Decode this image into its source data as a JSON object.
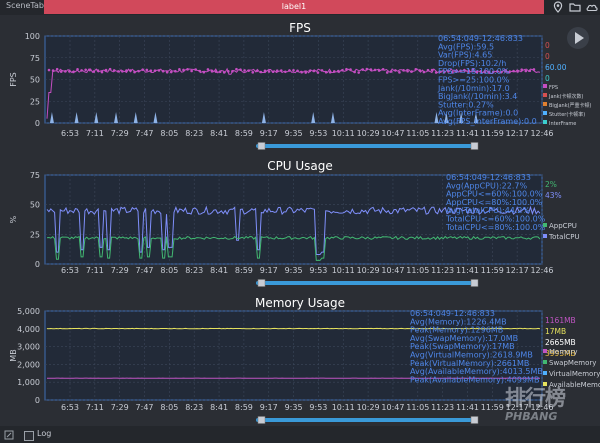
{
  "window": {
    "scene_tab": "SceneTab",
    "tab_label": "label1"
  },
  "toolbar_icons": [
    "location-pin-icon",
    "folder-icon",
    "cloud-icon"
  ],
  "bottom": {
    "log_label": "Log"
  },
  "watermark": {
    "cn": "排行榜",
    "en": "PHBANG"
  },
  "x_ticks": [
    "6:53",
    "7:11",
    "7:29",
    "7:47",
    "8:05",
    "8:23",
    "8:41",
    "8:59",
    "9:17",
    "9:35",
    "9:53",
    "10:11",
    "10:29",
    "10:47",
    "11:05",
    "11:23",
    "11:41",
    "11:59",
    "12:17",
    "12:46"
  ],
  "colors": {
    "panel_bg": "#2a3344",
    "plot_bg": "#222a38",
    "grid": "#3c475a",
    "fps": "#c44ec2",
    "appcpu": "#7f8ffb",
    "totalcpu": "#42b872",
    "memory": "#c055c3",
    "virtual": "#e6e25e",
    "stats": "#4e86e8",
    "scrollbar": "#3a9ad9"
  },
  "chart_data": [
    {
      "type": "line",
      "title": "FPS",
      "ylabel": "FPS",
      "ylim": [
        0,
        100
      ],
      "yticks": [
        "0",
        "25",
        "50",
        "75",
        "100"
      ],
      "stats": [
        "06:54:049-12:46:833",
        "Avg(FPS):59.5",
        "Var(FPS):4.65",
        "Drop(FPS):10.2/h",
        "FPS>=18:100.0%",
        "FPS>=25:100.0%",
        "Jank(/10min):17.0",
        "BigJank(/10min):3.4",
        "Stutter:0.27%",
        "Avg(InterFrame):0.0",
        "Avg(FPS_InterFrame):0.0"
      ],
      "right_values": [
        {
          "text": "0",
          "color": "#d55050"
        },
        {
          "text": "0",
          "color": "#d55050"
        },
        {
          "text": "60.00",
          "color": "#4fb0ff"
        },
        {
          "text": "0",
          "color": "#3ccfcf"
        }
      ],
      "legend": [
        {
          "name": "FPS",
          "color": "#c44ec2"
        },
        {
          "name": "Jank(卡顿次数)",
          "color": "#d55050"
        },
        {
          "name": "BigJank(严重卡顿)",
          "color": "#e08030"
        },
        {
          "name": "Stutter(卡顿率)",
          "color": "#4fb0ff"
        },
        {
          "name": "InterFrame",
          "color": "#3ccfcf"
        }
      ],
      "series": [
        {
          "name": "FPS",
          "base": 60,
          "noise": 2.2,
          "dips": [
            [
              0.0,
              5
            ],
            [
              0.004,
              35
            ],
            [
              0.37,
              56
            ],
            [
              0.9,
              57
            ]
          ],
          "color": "#c44ec2"
        }
      ],
      "events": [
        0.01,
        0.06,
        0.1,
        0.14,
        0.18,
        0.22,
        0.44,
        0.54,
        0.58,
        0.79,
        0.81,
        0.84,
        0.87
      ]
    },
    {
      "type": "line",
      "title": "CPU Usage",
      "ylabel": "%",
      "ylim": [
        0,
        75
      ],
      "yticks": [
        "0",
        "25",
        "50",
        "75"
      ],
      "stats": [
        "06:54:049-12:46:833",
        "Avg(AppCPU):22.7%",
        "AppCPU<=60%:100.0%",
        "AppCPU<=80%:100.0%",
        "Avg(TotalCPU):44.2%",
        "TotalCPU<=60%:100.0%",
        "TotalCPU<=80%:100.0%"
      ],
      "right_values": [
        {
          "text": "2%",
          "color": "#42b872"
        },
        {
          "text": "43%",
          "color": "#7f8ffb"
        }
      ],
      "legend": [
        {
          "name": "AppCPU",
          "color": "#42b872"
        },
        {
          "name": "TotalCPU",
          "color": "#7f8ffb"
        }
      ],
      "series": [
        {
          "name": "TotalCPU",
          "base": 45,
          "noise": 3,
          "dips": [
            [
              0.02,
              10
            ],
            [
              0.07,
              12
            ],
            [
              0.11,
              14
            ],
            [
              0.125,
              12
            ],
            [
              0.19,
              10
            ],
            [
              0.205,
              14
            ],
            [
              0.235,
              12
            ],
            [
              0.25,
              14
            ],
            [
              0.385,
              20
            ],
            [
              0.43,
              12
            ],
            [
              0.55,
              8
            ],
            [
              0.56,
              10
            ]
          ],
          "color": "#7f8ffb"
        },
        {
          "name": "AppCPU",
          "base": 22,
          "noise": 1.2,
          "dips": [
            [
              0.02,
              4
            ],
            [
              0.07,
              6
            ],
            [
              0.11,
              6
            ],
            [
              0.125,
              5
            ],
            [
              0.19,
              5
            ],
            [
              0.205,
              6
            ],
            [
              0.235,
              5
            ],
            [
              0.25,
              6
            ],
            [
              0.43,
              5
            ],
            [
              0.55,
              3
            ],
            [
              0.56,
              5
            ]
          ],
          "color": "#42b872"
        }
      ]
    },
    {
      "type": "line",
      "title": "Memory Usage",
      "ylabel": "MB",
      "ylim": [
        0,
        5000
      ],
      "yticks": [
        "0",
        "1,000",
        "2,000",
        "3,000",
        "4,000",
        "5,000"
      ],
      "stats": [
        "06:54:049-12:46:833",
        "Avg(Memory):1226.4MB",
        "Peak(Memory):1296MB",
        "Avg(SwapMemory):17.0MB",
        "Peak(SwapMemory):17MB",
        "Avg(VirtualMemory):2618.9MB",
        "Peak(VirtualMemory):2661MB",
        "Avg(AvailableMemory):4013.5MB",
        "Peak(AvailableMemory):4099MB"
      ],
      "right_values": [
        {
          "text": "1161MB",
          "color": "#c055c3"
        },
        {
          "text": "17MB",
          "color": "#e6e25e"
        },
        {
          "text": "2665MB",
          "color": "#ffffff"
        },
        {
          "text": "3993MB",
          "color": "#f0c040"
        }
      ],
      "legend": [
        {
          "name": "Memory",
          "color": "#c055c3"
        },
        {
          "name": "SwapMemory",
          "color": "#42b872"
        },
        {
          "name": "VirtualMemory",
          "color": "#4fb0ff"
        },
        {
          "name": "AvailableMemory",
          "color": "#e6e25e"
        }
      ],
      "series": [
        {
          "name": "AvailableMemory",
          "base": 4013,
          "noise": 10,
          "dips": [],
          "color": "#e6e25e"
        },
        {
          "name": "Memory",
          "base": 1226,
          "noise": 5,
          "dips": [],
          "color": "#c055c3"
        }
      ]
    }
  ]
}
